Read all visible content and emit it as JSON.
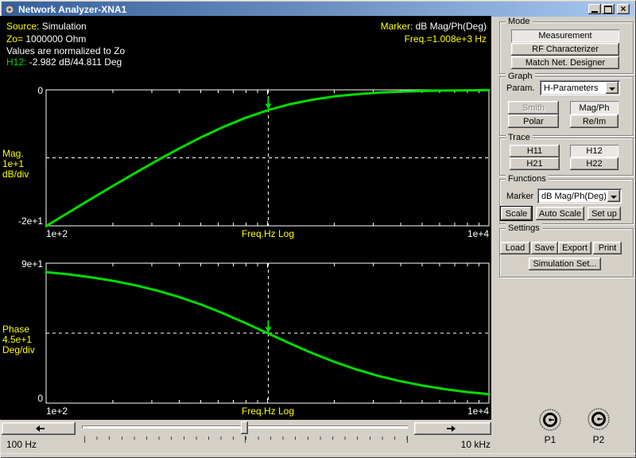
{
  "window": {
    "title": "Network Analyzer-XNA1"
  },
  "readout": {
    "source_label": "Source:",
    "source_value": "Simulation",
    "zo_label": "Zo=",
    "zo_value": "1000000 Ohm",
    "normalize_note": "Values are normalized to Zo",
    "trace_label": "H12:",
    "trace_value": "-2.982 dB/44.811 Deg",
    "marker_label": "Marker:",
    "marker_value": "dB Mag/Ph(Deg)",
    "marker_freq": "Freq.=1.008e+3 Hz"
  },
  "chart_data": [
    {
      "type": "line",
      "name": "H12 magnitude",
      "x_scale": "log",
      "x_range": [
        100,
        10000
      ],
      "y_range": [
        -20,
        0
      ],
      "x_label_left": "1e+2",
      "x_label_center": "Freq.Hz Log",
      "x_label_right": "1e+4",
      "y_label_top": "0",
      "y_label_bottom": "-2e+1",
      "axis_unit_lines": [
        "Mag.",
        "1e+1",
        "dB/div"
      ],
      "x": [
        100,
        126,
        158,
        200,
        251,
        316,
        398,
        501,
        631,
        794,
        1000,
        1259,
        1585,
        1995,
        2512,
        3162,
        3981,
        5012,
        6310,
        7943,
        10000
      ],
      "y": [
        -20.04,
        -18.06,
        -16.13,
        -14.15,
        -12.27,
        -10.42,
        -8.64,
        -6.98,
        -5.46,
        -4.13,
        -3.01,
        -2.12,
        -1.46,
        -0.97,
        -0.64,
        -0.41,
        -0.27,
        -0.17,
        -0.11,
        -0.07,
        -0.04
      ],
      "marker": {
        "x": 1008,
        "y": -2.982
      },
      "color": "#00dc00",
      "grid": "dashed-midline"
    },
    {
      "type": "line",
      "name": "H12 phase",
      "x_scale": "log",
      "x_range": [
        100,
        10000
      ],
      "y_range": [
        0,
        90
      ],
      "x_label_left": "1e+2",
      "x_label_center": "Freq.Hz Log",
      "x_label_right": "1e+4",
      "y_label_top": "9e+1",
      "y_label_bottom": "0",
      "axis_unit_lines": [
        "Phase",
        "4.5e+1",
        "Deg/div"
      ],
      "x": [
        100,
        126,
        158,
        200,
        251,
        316,
        398,
        501,
        631,
        794,
        1000,
        1259,
        1585,
        1995,
        2512,
        3162,
        3981,
        5012,
        6310,
        7943,
        10000
      ],
      "y": [
        84.29,
        82.82,
        81.02,
        78.69,
        75.91,
        72.47,
        68.31,
        63.39,
        57.75,
        51.55,
        45.0,
        38.45,
        32.25,
        26.63,
        21.71,
        17.54,
        14.1,
        11.28,
        9.01,
        7.17,
        5.71
      ],
      "marker": {
        "x": 1008,
        "y": 44.811
      },
      "color": "#00dc00",
      "grid": "dashed-midline"
    }
  ],
  "panel": {
    "mode": {
      "label": "Mode",
      "buttons": [
        {
          "label": "Measurement",
          "state": "selected"
        },
        {
          "label": "RF Characterizer",
          "state": "normal"
        },
        {
          "label": "Match Net. Designer",
          "state": "normal"
        }
      ]
    },
    "graph": {
      "label": "Graph",
      "param_label": "Param.",
      "param_value": "H-Parameters",
      "buttons": [
        {
          "label": "Smith",
          "state": "disabled"
        },
        {
          "label": "Mag/Ph",
          "state": "selected"
        },
        {
          "label": "Polar",
          "state": "normal"
        },
        {
          "label": "Re/Im",
          "state": "normal"
        }
      ]
    },
    "trace": {
      "label": "Trace",
      "buttons": [
        {
          "label": "H11",
          "state": "normal"
        },
        {
          "label": "H12",
          "state": "selected"
        },
        {
          "label": "H21",
          "state": "normal"
        },
        {
          "label": "H22",
          "state": "normal"
        }
      ]
    },
    "functions": {
      "label": "Functions",
      "marker_label": "Marker",
      "marker_value": "dB Mag/Ph(Deg)",
      "buttons": [
        "Scale",
        "Auto Scale",
        "Set up"
      ]
    },
    "settings": {
      "label": "Settings",
      "buttons": [
        "Load",
        "Save",
        "Export",
        "Print"
      ],
      "sim_button": "Simulation Set..."
    }
  },
  "freq_bar": {
    "min_label": "100 Hz",
    "max_label": "10 kHz"
  },
  "ports": {
    "p1": "P1",
    "p2": "P2"
  },
  "colors": {
    "trace_green": "#00dc00",
    "label_yellow": "#ffff00",
    "plot_bg": "#000000",
    "panel_gray": "#d4d0c8",
    "titlebar_left": "#35609d",
    "titlebar_right": "#a9c9f1"
  }
}
